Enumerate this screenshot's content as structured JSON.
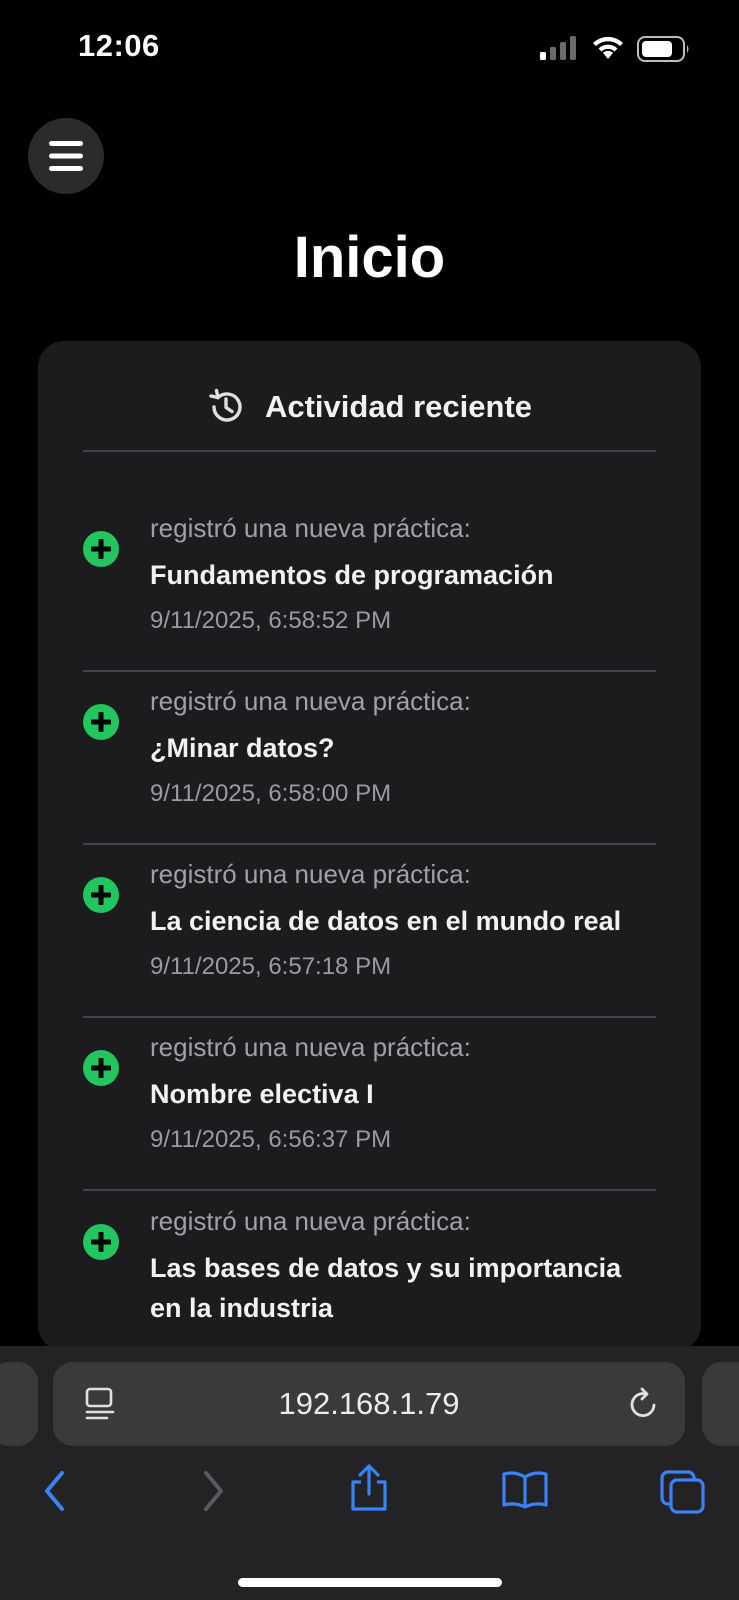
{
  "status_bar": {
    "time": "12:06"
  },
  "header": {
    "title": "Inicio"
  },
  "card": {
    "title": "Actividad reciente",
    "items": [
      {
        "action": "registró una nueva práctica:",
        "name": "Fundamentos de programación",
        "timestamp": "9/11/2025, 6:58:52 PM"
      },
      {
        "action": "registró una nueva práctica:",
        "name": "¿Minar datos?",
        "timestamp": "9/11/2025, 6:58:00 PM"
      },
      {
        "action": "registró una nueva práctica:",
        "name": "La ciencia de datos en el mundo real",
        "timestamp": "9/11/2025, 6:57:18 PM"
      },
      {
        "action": "registró una nueva práctica:",
        "name": "Nombre electiva I",
        "timestamp": "9/11/2025, 6:56:37 PM"
      },
      {
        "action": "registró una nueva práctica:",
        "name": "Las bases de datos y su importancia en la industria",
        "timestamp": ""
      }
    ]
  },
  "browser": {
    "url": "192.168.1.79"
  },
  "colors": {
    "accent_green": "#22c55e",
    "safari_blue": "#3b82f6",
    "card_bg": "#1c1c1e"
  },
  "icons": {
    "menu": "hamburger-icon",
    "history": "history-icon",
    "item": "plus-circle-icon",
    "reader": "reader-mode-icon",
    "reload": "reload-icon",
    "back": "chevron-left-icon",
    "forward": "chevron-right-icon",
    "share": "share-icon",
    "bookmarks": "bookmarks-icon",
    "tabs": "tabs-icon"
  }
}
